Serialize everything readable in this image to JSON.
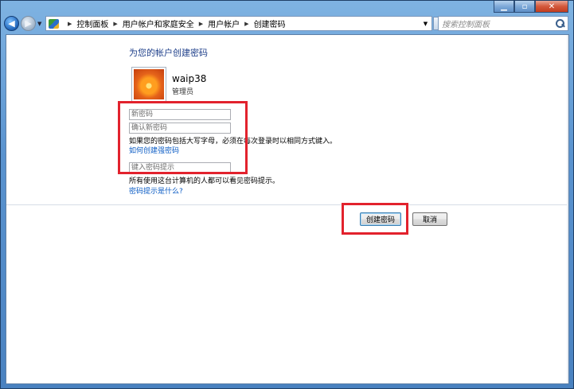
{
  "breadcrumb": {
    "items": [
      "控制面板",
      "用户帐户和家庭安全",
      "用户帐户",
      "创建密码"
    ]
  },
  "search": {
    "placeholder": "搜索控制面板"
  },
  "page": {
    "title": "为您的帐户创建密码",
    "user_name": "waip38",
    "user_role": "管理员"
  },
  "form": {
    "new_password_placeholder": "新密码",
    "confirm_password_placeholder": "确认新密码",
    "case_note": "如果您的密码包括大写字母，必须在每次登录时以相同方式键入。",
    "strong_password_link": "如何创建强密码",
    "hint_placeholder": "键入密码提示",
    "hint_note": "所有使用这台计算机的人都可以看见密码提示。",
    "hint_what_link": "密码提示是什么?"
  },
  "buttons": {
    "create": "创建密码",
    "cancel": "取消"
  },
  "icons": {
    "back": "back-arrow-icon",
    "forward": "forward-arrow-icon",
    "refresh": "refresh-icon",
    "search": "search-icon",
    "address": "control-panel-icon"
  },
  "colors": {
    "title_blue": "#1e3f8a",
    "link_blue": "#0a5bc4",
    "highlight_red": "#e2222d"
  }
}
